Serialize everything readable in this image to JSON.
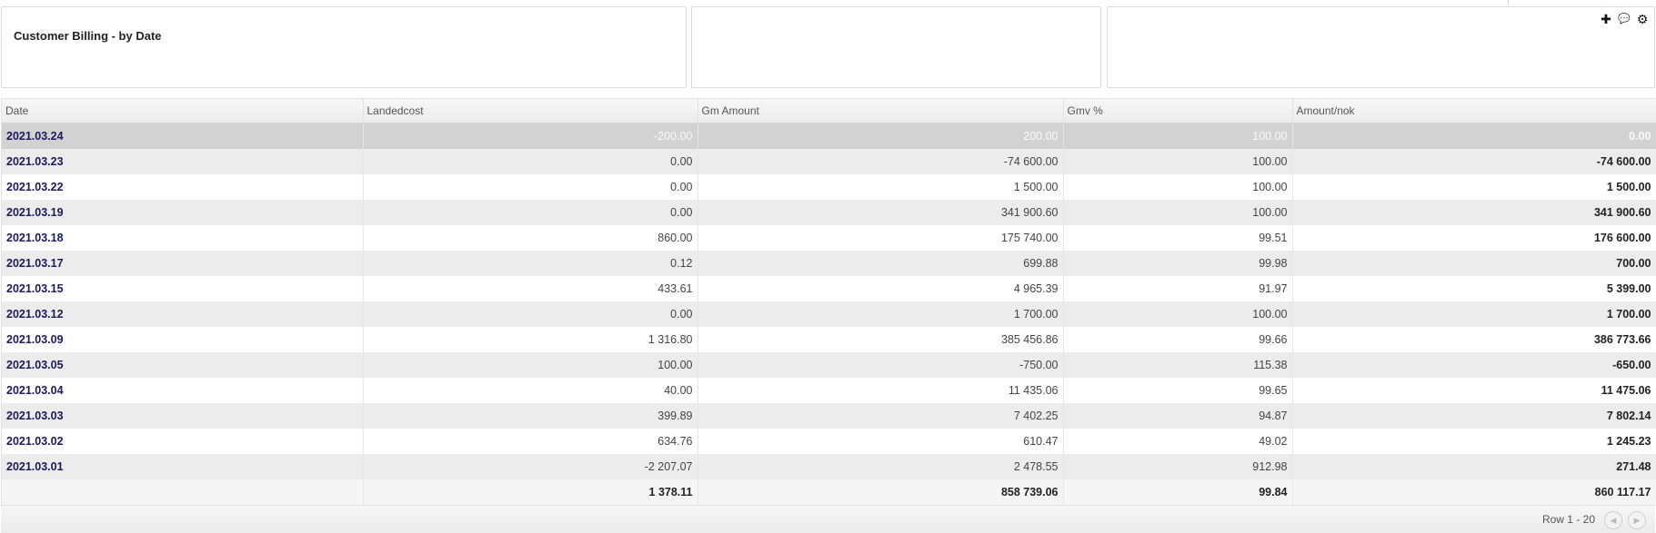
{
  "header": {
    "title": "Customer Billing - by Date",
    "tools": [
      {
        "icon": "plus-icon",
        "glyph": "✚"
      },
      {
        "icon": "chat-icon",
        "glyph": "💬"
      },
      {
        "icon": "gear-icon",
        "glyph": "⚙"
      }
    ]
  },
  "table": {
    "columns": [
      "Date",
      "Landedcost",
      "Gm Amount",
      "Gmv %",
      "Amount/nok"
    ],
    "rows": [
      [
        "2021.03.24",
        "-200.00",
        "200.00",
        "100.00",
        "0.00"
      ],
      [
        "2021.03.23",
        "0.00",
        "-74 600.00",
        "100.00",
        "-74 600.00"
      ],
      [
        "2021.03.22",
        "0.00",
        "1 500.00",
        "100.00",
        "1 500.00"
      ],
      [
        "2021.03.19",
        "0.00",
        "341 900.60",
        "100.00",
        "341 900.60"
      ],
      [
        "2021.03.18",
        "860.00",
        "175 740.00",
        "99.51",
        "176 600.00"
      ],
      [
        "2021.03.17",
        "0.12",
        "699.88",
        "99.98",
        "700.00"
      ],
      [
        "2021.03.15",
        "433.61",
        "4 965.39",
        "91.97",
        "5 399.00"
      ],
      [
        "2021.03.12",
        "0.00",
        "1 700.00",
        "100.00",
        "1 700.00"
      ],
      [
        "2021.03.09",
        "1 316.80",
        "385 456.86",
        "99.66",
        "386 773.66"
      ],
      [
        "2021.03.05",
        "100.00",
        "-750.00",
        "115.38",
        "-650.00"
      ],
      [
        "2021.03.04",
        "40.00",
        "11 435.06",
        "99.65",
        "11 475.06"
      ],
      [
        "2021.03.03",
        "399.89",
        "7 402.25",
        "94.87",
        "7 802.14"
      ],
      [
        "2021.03.02",
        "634.76",
        "610.47",
        "49.02",
        "1 245.23"
      ],
      [
        "2021.03.01",
        "-2 207.07",
        "2 478.55",
        "912.98",
        "271.48"
      ]
    ],
    "selected_row": 0,
    "totals": [
      "",
      "1 378.11",
      "858 739.06",
      "99.84",
      "860 117.17"
    ]
  },
  "pager": {
    "row_info": "Row 1 - 20",
    "prev_glyph": "◀",
    "next_glyph": "▶"
  }
}
